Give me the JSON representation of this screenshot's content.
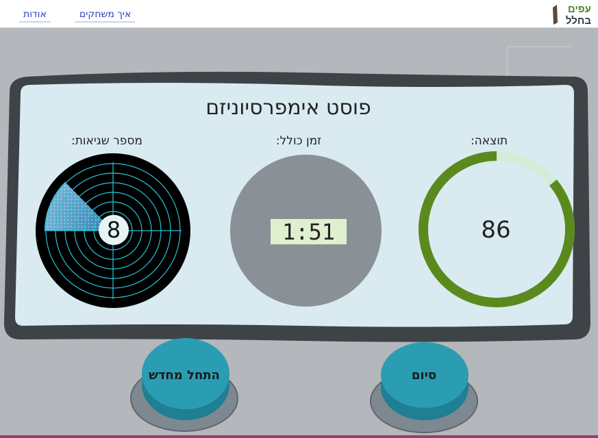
{
  "nav": {
    "about_label": "אודות",
    "how_to_play_label": "איך משחקים"
  },
  "logo": {
    "line1": "עפים",
    "line2": "בחלל"
  },
  "game": {
    "title": "פוסט אימפרסיוניזם"
  },
  "stats": {
    "score_label": "תוצאה:",
    "score_value": "86",
    "score_percent": 86,
    "time_label": "זמן כולל:",
    "time_value": "1:51",
    "errors_label": "מספר שגיאות:",
    "errors_value": "8"
  },
  "buttons": {
    "restart_label": "התחל מחדש",
    "finish_label": "סיום"
  },
  "colors": {
    "score_ring": "#5a8a1e",
    "score_track": "#d5ecd6",
    "button_face": "#2a9db2",
    "panel_bg": "#d9ebf0",
    "panel_frame": "#3d4347",
    "radar_lines": "#27c6d6"
  }
}
